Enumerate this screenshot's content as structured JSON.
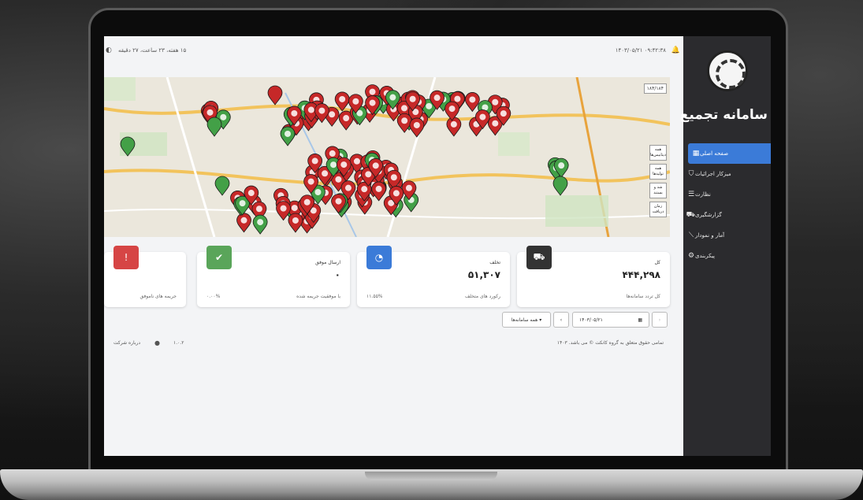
{
  "app": {
    "title": "سامانه تجمیع",
    "datetime": "۱۴۰۳/۰۵/۲۱  ۰۹:۴۲:۳۸",
    "uptime": "۱۵ هفته، ۲۳ ساعت، ۲۷ دقیقه"
  },
  "sidebar": {
    "items": [
      {
        "label": "صفحه اصلی",
        "icon": "grid-icon",
        "glyph": "▦",
        "active": true
      },
      {
        "label": "میزکار اجرائیات",
        "icon": "shield-icon",
        "glyph": "⛉",
        "active": false
      },
      {
        "label": "نظارت",
        "icon": "list-icon",
        "glyph": "☰",
        "active": false
      },
      {
        "label": "گزارشگیری",
        "icon": "car-icon",
        "glyph": "⛟",
        "active": false
      },
      {
        "label": "آمار و نمودار",
        "icon": "chart-icon",
        "glyph": "⟋",
        "active": false
      },
      {
        "label": "پیکربندی",
        "icon": "gear-icon",
        "glyph": "⚙",
        "active": false
      }
    ]
  },
  "map": {
    "counter": "۱۸۴/۱۸۴",
    "filters": [
      "همه دیتابیس‌ها",
      "همه تولیدها",
      "شد و بستند",
      "زمان دریافت"
    ],
    "colors": {
      "red": "#c62828",
      "green": "#43a047"
    }
  },
  "cards": [
    {
      "label": "کل",
      "value": "۴۴۴,۲۹۸",
      "sub": "کل تردد سامانه‌ها",
      "pct": "",
      "color": "#333333",
      "icon": "car-icon",
      "glyph": "⛟"
    },
    {
      "label": "تخلف",
      "value": "۵۱,۳۰۷",
      "sub": "رکورد های متخلف",
      "pct": "۱۱.۵۵%",
      "color": "#3b7bd8",
      "icon": "speedometer-icon",
      "glyph": "◔"
    },
    {
      "label": "ارسال موفق",
      "value": "۰",
      "sub": "با موفقیت جریمه شده",
      "pct": "۰.۰۰%",
      "color": "#5aa55a",
      "icon": "shield-check-icon",
      "glyph": "✔"
    },
    {
      "label": "",
      "value": "",
      "sub": "جریمه های ناموفق",
      "pct": "",
      "color": "#d64545",
      "icon": "alert-icon",
      "glyph": "!"
    }
  ],
  "filters": {
    "date": "۱۴۰۳/۰۵/۲۱",
    "systems": "همه سامانه‌ها"
  },
  "footer": {
    "copyright": "تمامی حقوق متعلق به گروه کانکت © می باشد. ۱۴۰۳",
    "about": "درباره شرکت",
    "version": "۱.۰.۲"
  }
}
